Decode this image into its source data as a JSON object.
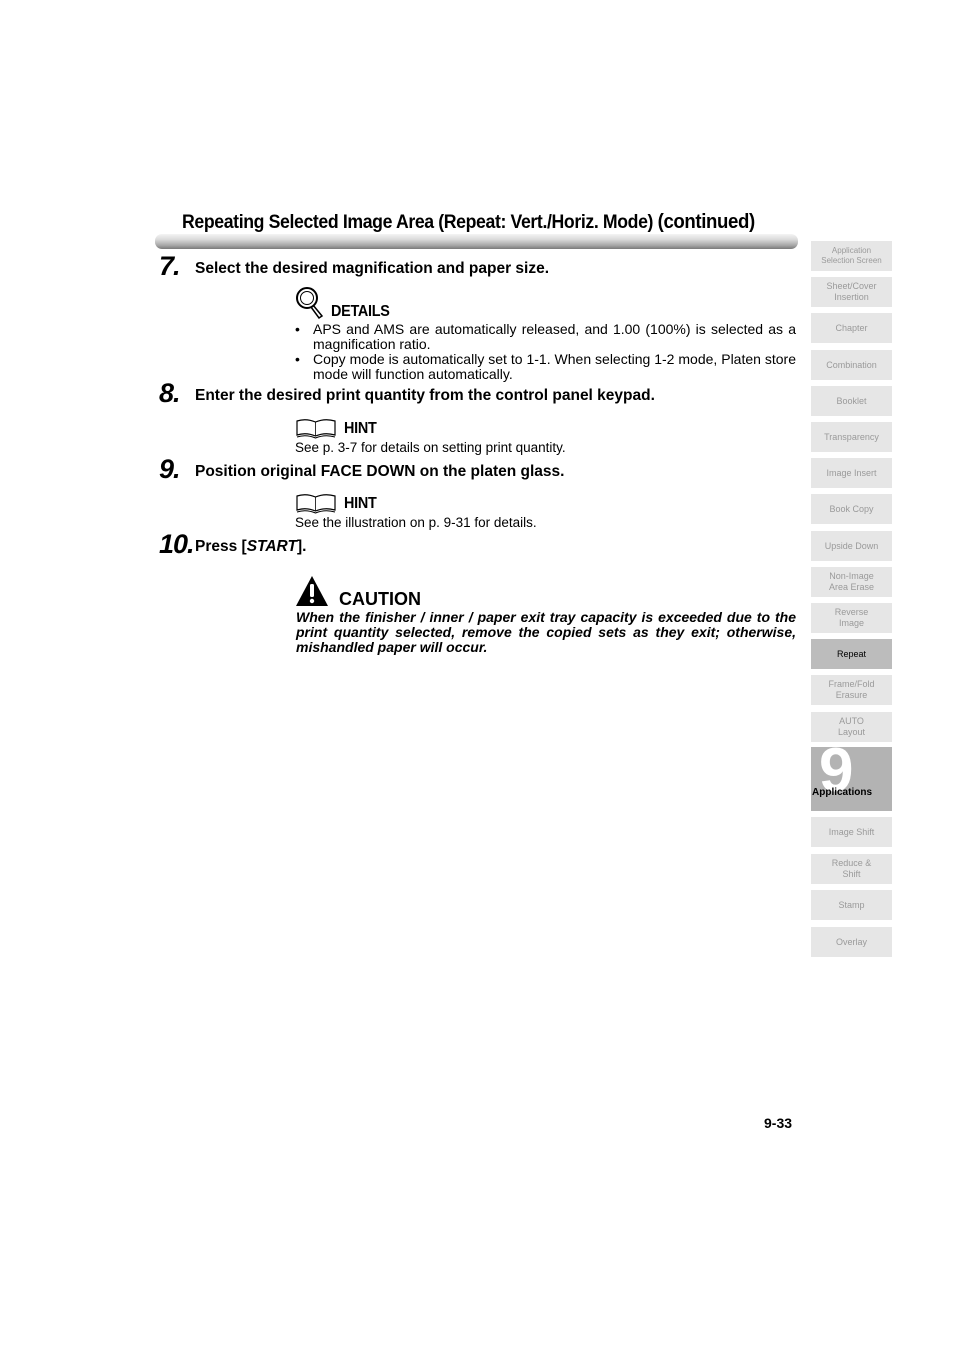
{
  "header": {
    "title": "Repeating Selected Image Area (Repeat: Vert./Horiz. Mode)",
    "title_suffix": "(continued)"
  },
  "steps": [
    {
      "number": "7.",
      "text": "Select the desired magnification and paper size.",
      "note": {
        "type": "DETAILS",
        "icon": "magnifier-icon",
        "bullets": [
          "APS and AMS are automatically released, and 1.00 (100%) is selected as a magnification ratio.",
          "Copy mode is automatically set to 1-1. When selecting 1-2 mode, Platen store mode will function automatically."
        ]
      }
    },
    {
      "number": "8.",
      "text": "Enter the desired print quantity from the control panel keypad.",
      "note": {
        "type": "HINT",
        "icon": "book-icon",
        "text": "See p. 3-7 for details on setting print quantity."
      }
    },
    {
      "number": "9.",
      "text": "Position original FACE DOWN on the platen glass.",
      "note": {
        "type": "HINT",
        "icon": "book-icon",
        "text": "See the illustration on p. 9-31 for details."
      }
    },
    {
      "number": "10.",
      "text_prefix": "Press [",
      "text_emph": "START",
      "text_suffix": "].",
      "caution": {
        "label": "CAUTION",
        "icon": "warning-icon",
        "text": "When the finisher / inner / paper exit tray capacity is exceeded due to the print quantity selected, remove the copied sets as they exit; otherwise, mishandled paper will occur."
      }
    }
  ],
  "page_number": "9-33",
  "sidebar": {
    "tabs": [
      {
        "label": "Application\nSelection Screen",
        "active": false
      },
      {
        "label": "Sheet/Cover\nInsertion",
        "active": false
      },
      {
        "label": "Chapter",
        "active": false
      },
      {
        "label": "Combination",
        "active": false
      },
      {
        "label": "Booklet",
        "active": false
      },
      {
        "label": "Transparency",
        "active": false
      },
      {
        "label": "Image Insert",
        "active": false
      },
      {
        "label": "Book Copy",
        "active": false
      },
      {
        "label": "Upside Down",
        "active": false
      },
      {
        "label": "Non-Image\nArea Erase",
        "active": false
      },
      {
        "label": "Reverse\nImage",
        "active": false
      },
      {
        "label": "Repeat",
        "active": true
      },
      {
        "label": "Frame/Fold\nErasure",
        "active": false
      },
      {
        "label": "AUTO\nLayout",
        "active": false
      }
    ],
    "chapter": {
      "number": "9",
      "label": "Applications"
    },
    "tabs_after": [
      {
        "label": "Image Shift",
        "active": false
      },
      {
        "label": "Reduce &\nShift",
        "active": false
      },
      {
        "label": "Stamp",
        "active": false
      },
      {
        "label": "Overlay",
        "active": false
      }
    ]
  }
}
